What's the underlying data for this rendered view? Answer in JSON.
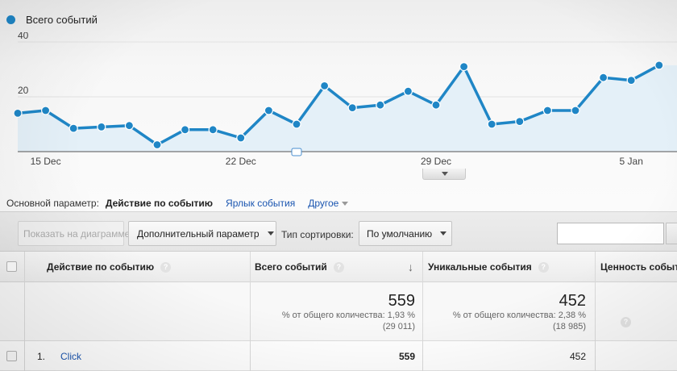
{
  "legend": {
    "label": "Всего событий",
    "color": "#1f86c6"
  },
  "chart_data": {
    "type": "area",
    "series": [
      {
        "name": "Всего событий",
        "values": [
          14,
          15,
          8.5,
          9,
          9.5,
          2.5,
          8,
          8,
          5,
          15,
          10,
          24,
          16,
          17,
          22,
          17,
          31,
          10,
          11,
          15,
          15,
          27,
          26,
          31.5
        ]
      }
    ],
    "x_tick_labels": [
      "15 Dec",
      "22 Dec",
      "29 Dec",
      "5 Jan"
    ],
    "x_tick_index": [
      1,
      8,
      15,
      22
    ],
    "y_tick_labels": [
      "20",
      "40"
    ],
    "y_tick_values": [
      20,
      40
    ],
    "ylim": [
      0,
      40
    ],
    "line_color": "#1f86c6",
    "fill_color": "#e4f0f8",
    "grid": true
  },
  "dimensions": {
    "label": "Основной параметр:",
    "active": "Действие по событию",
    "link": "Ярлык события",
    "other": "Другое"
  },
  "toolbar": {
    "plot_button": "Показать на диаграмме",
    "secondary_dim": "Дополнительный параметр",
    "sort_label": "Тип сортировки:",
    "sort_value": "По умолчанию",
    "search_value": ""
  },
  "table": {
    "headers": {
      "action": "Действие по событию",
      "total": "Всего событий",
      "unique": "Уникальные события",
      "value": "Ценность события"
    },
    "totals": {
      "total_value": "559",
      "total_share": "% от общего количества: 1,93 %",
      "total_of": "(29 011)",
      "unique_value": "452",
      "unique_share": "% от общего количества: 2,38 %",
      "unique_of": "(18 985)"
    },
    "rows": [
      {
        "index": "1.",
        "action": "Click",
        "total": "559",
        "unique": "452"
      }
    ]
  }
}
